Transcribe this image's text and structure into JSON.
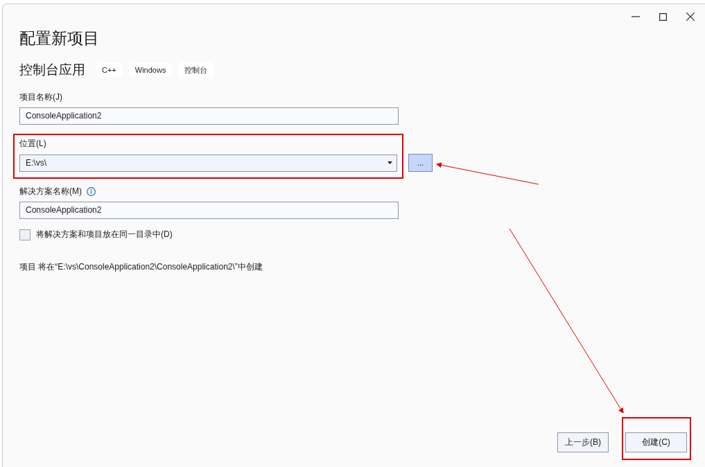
{
  "title": "配置新项目",
  "template": {
    "name": "控制台应用",
    "tags": [
      "C++",
      "Windows",
      "控制台"
    ]
  },
  "project_name": {
    "label": "项目名称(J)",
    "value": "ConsoleApplication2"
  },
  "location": {
    "label": "位置(L)",
    "value": "E:\\vs\\",
    "browse": "..."
  },
  "solution_name": {
    "label": "解决方案名称(M)",
    "value": "ConsoleApplication2"
  },
  "same_directory": {
    "label": "将解决方案和项目放在同一目录中(D)",
    "checked": false
  },
  "summary": "项目 将在“E:\\vs\\ConsoleApplication2\\ConsoleApplication2\\”中创建",
  "buttons": [
    {
      "label": "上一步(B)",
      "kind": "secondary"
    },
    {
      "label": "创建(C)",
      "kind": "primary"
    }
  ]
}
